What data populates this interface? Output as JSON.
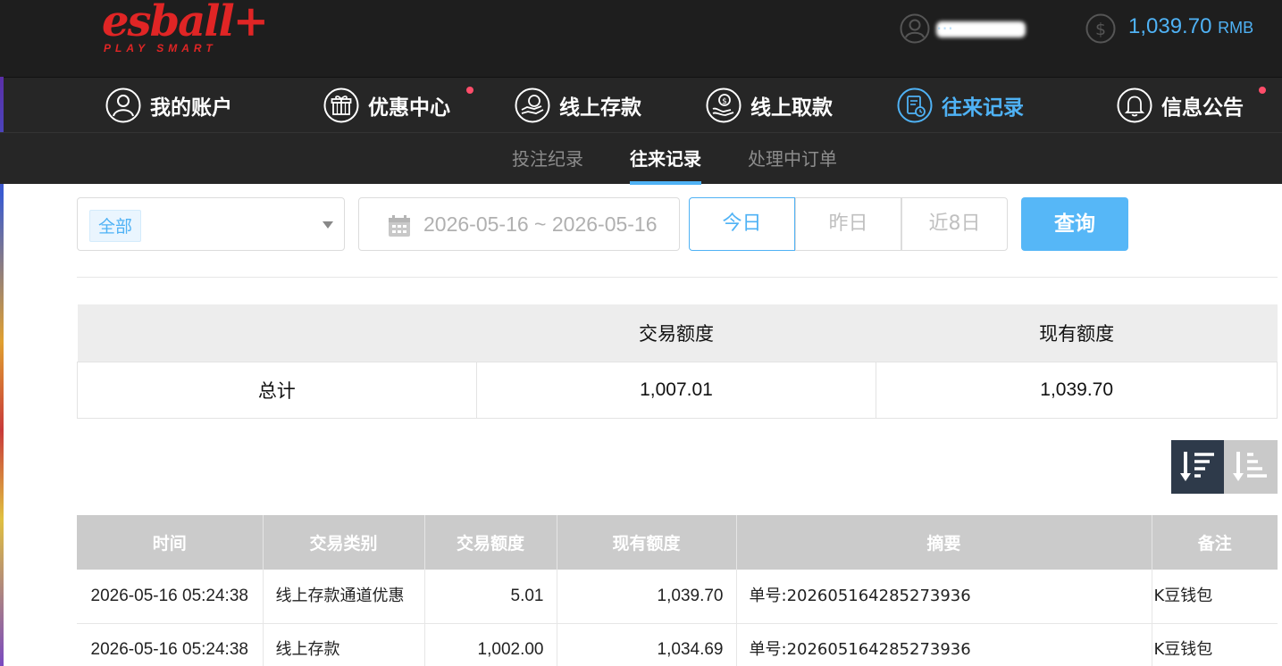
{
  "header": {
    "logo_text": "esball+",
    "logo_tagline": "PLAY SMART",
    "username": "···",
    "balance": "1,039.70",
    "currency": "RMB"
  },
  "main_nav": [
    {
      "label": "我的账户",
      "icon": "user-circle-icon",
      "active": false,
      "badge": false
    },
    {
      "label": "优惠中心",
      "icon": "gift-icon",
      "active": false,
      "badge": true
    },
    {
      "label": "线上存款",
      "icon": "deposit-icon",
      "active": false,
      "badge": false
    },
    {
      "label": "线上取款",
      "icon": "withdraw-icon",
      "active": false,
      "badge": false
    },
    {
      "label": "往来记录",
      "icon": "records-icon",
      "active": true,
      "badge": false
    },
    {
      "label": "信息公告",
      "icon": "bell-icon",
      "active": false,
      "badge": true
    }
  ],
  "sub_nav": [
    {
      "label": "投注纪录",
      "active": false
    },
    {
      "label": "往来记录",
      "active": true
    },
    {
      "label": "处理中订单",
      "active": false
    }
  ],
  "filters": {
    "type_selected": "全部",
    "date_range": "2026-05-16 ~ 2026-05-16",
    "ranges": [
      "今日",
      "昨日",
      "近8日"
    ],
    "active_range": "今日",
    "query_label": "查询"
  },
  "summary": {
    "headers": [
      "",
      "交易额度",
      "现有额度"
    ],
    "row": [
      "总计",
      "1,007.01",
      "1,039.70"
    ]
  },
  "records": {
    "headers": [
      "时间",
      "交易类别",
      "交易额度",
      "现有额度",
      "摘要",
      "备注"
    ],
    "rows": [
      [
        "2026-05-16 05:24:38",
        "线上存款通道优惠",
        "5.01",
        "1,039.70",
        "单号:202605164285273936",
        "K豆钱包"
      ],
      [
        "2026-05-16 05:24:38",
        "线上存款",
        "1,002.00",
        "1,034.69",
        "单号:202605164285273936",
        "K豆钱包"
      ]
    ]
  },
  "colors": {
    "accent": "#4fb2f5",
    "header_bg": "#1e1e1e",
    "nav_bg": "#262626",
    "logo_red": "#e02525",
    "badge": "#ff4d6a"
  }
}
